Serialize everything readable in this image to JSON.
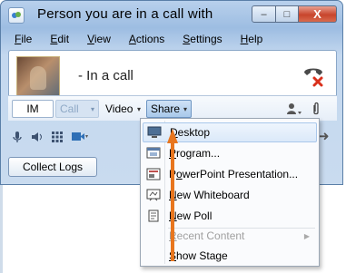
{
  "window": {
    "title": "Person you are in a call with",
    "controls": {
      "minimize": "–",
      "maximize": "□",
      "close": "X"
    }
  },
  "menubar": [
    {
      "label": "File",
      "key": "F",
      "rest": "ile"
    },
    {
      "label": "Edit",
      "key": "E",
      "rest": "dit"
    },
    {
      "label": "View",
      "key": "V",
      "rest": "iew"
    },
    {
      "label": "Actions",
      "key": "A",
      "rest": "ctions"
    },
    {
      "label": "Settings",
      "key": "S",
      "rest": "ettings"
    },
    {
      "label": "Help",
      "key": "H",
      "rest": "elp"
    }
  ],
  "contact": {
    "status": "- In a call"
  },
  "toolbar": {
    "im": "IM",
    "call": "Call",
    "video": "Video",
    "share": "Share",
    "dropdown_caret": "▾"
  },
  "bottom": {
    "collect_logs": "Collect Logs"
  },
  "share_menu": {
    "items": [
      {
        "label": "Desktop",
        "key": "D",
        "highlighted": true,
        "enabled": true,
        "icon": "desktop-icon"
      },
      {
        "label": "Program...",
        "key": "P",
        "enabled": true,
        "icon": "program-icon"
      },
      {
        "label": "PowerPoint Presentation...",
        "key": "o",
        "enabled": true,
        "icon": "powerpoint-icon"
      },
      {
        "label": "New Whiteboard",
        "key": "N",
        "enabled": true,
        "icon": "whiteboard-icon"
      },
      {
        "label": "New Poll",
        "key": "N",
        "enabled": true,
        "icon": "poll-icon"
      },
      {
        "label": "Recent Content",
        "key": "R",
        "enabled": false,
        "has_submenu": true
      },
      {
        "label": "Show Stage",
        "key": "S",
        "enabled": true
      }
    ],
    "submenu_arrow": "▶"
  },
  "colors": {
    "accent_arrow": "#e8761e",
    "hangup": "#d9301c",
    "share_highlight": "#a9c9ea"
  }
}
